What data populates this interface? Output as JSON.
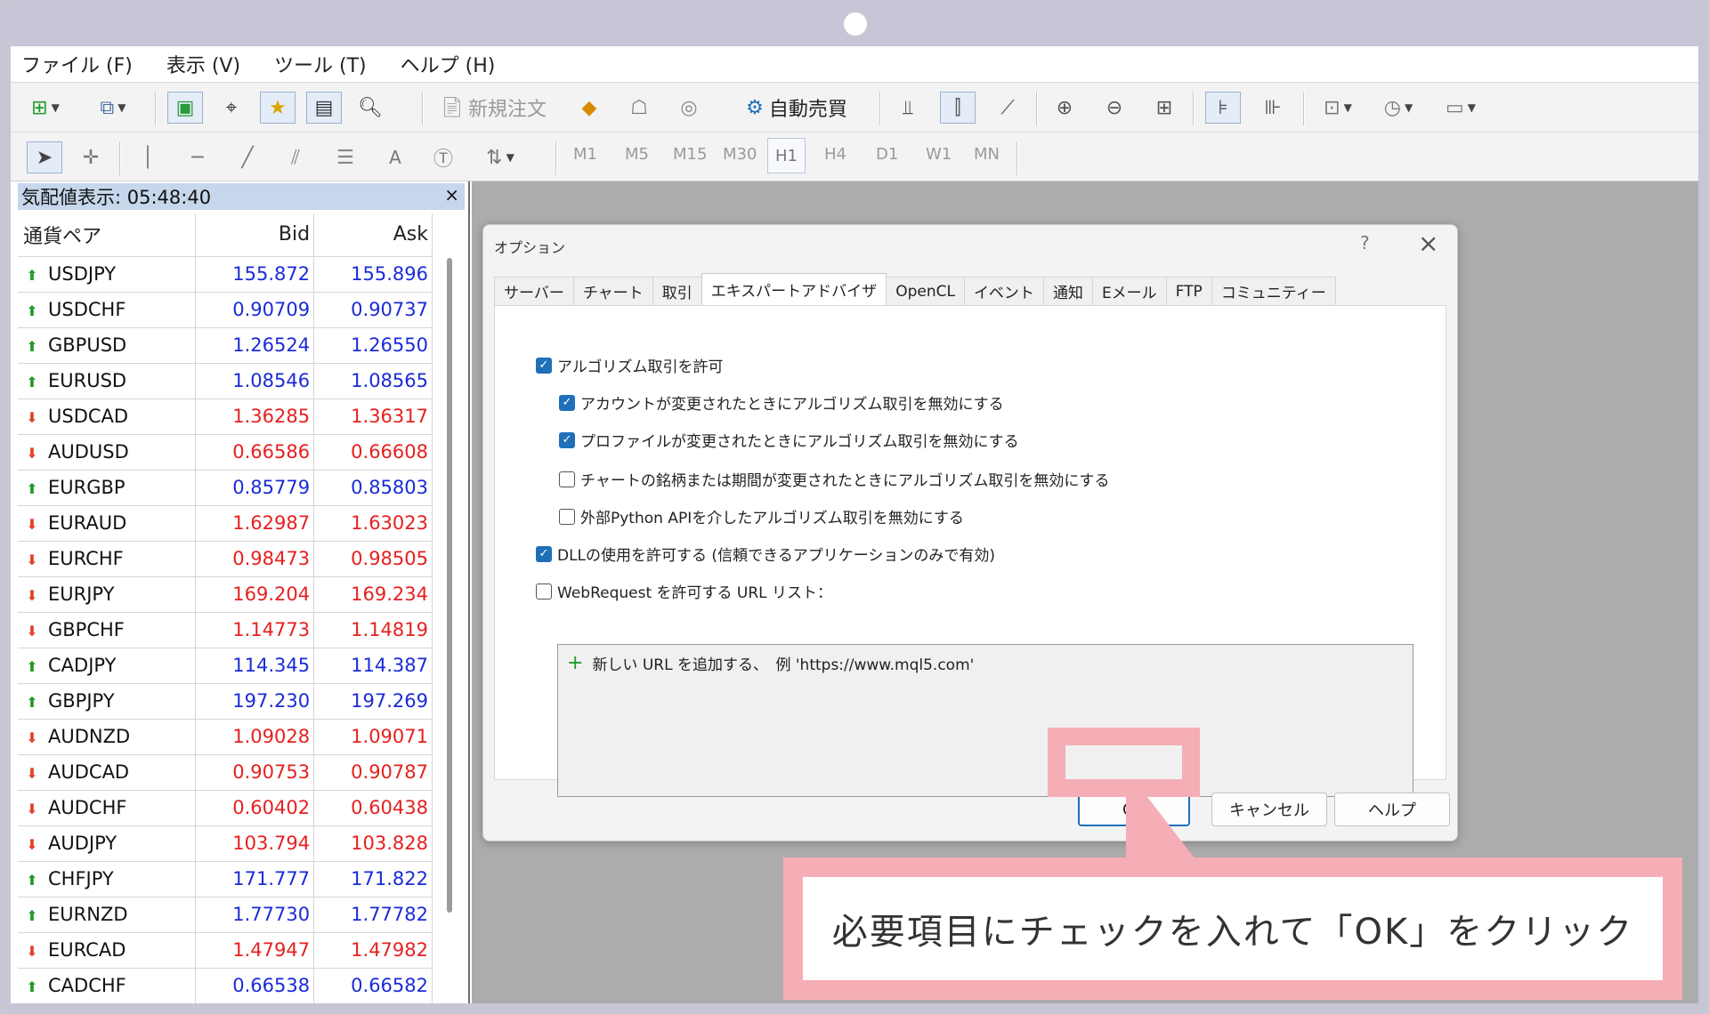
{
  "menu": [
    "ファイル (F)",
    "表示 (V)",
    "ツール (T)",
    "ヘルプ (H)"
  ],
  "toolbar": {
    "new_order": "新規注文",
    "auto_trading": "自動売買",
    "timeframes": [
      "M1",
      "M5",
      "M15",
      "M30",
      "H1",
      "H4",
      "D1",
      "W1",
      "MN"
    ],
    "active_timeframe": "H1",
    "text_tool": "A"
  },
  "market_watch": {
    "title": "気配値表示: 05:48:40",
    "close": "×",
    "columns": [
      "通貨ペア",
      "Bid",
      "Ask"
    ],
    "rows": [
      {
        "symbol": "USDJPY",
        "bid": "155.872",
        "ask": "155.896",
        "dir": "up"
      },
      {
        "symbol": "USDCHF",
        "bid": "0.90709",
        "ask": "0.90737",
        "dir": "up"
      },
      {
        "symbol": "GBPUSD",
        "bid": "1.26524",
        "ask": "1.26550",
        "dir": "up"
      },
      {
        "symbol": "EURUSD",
        "bid": "1.08546",
        "ask": "1.08565",
        "dir": "up"
      },
      {
        "symbol": "USDCAD",
        "bid": "1.36285",
        "ask": "1.36317",
        "dir": "down"
      },
      {
        "symbol": "AUDUSD",
        "bid": "0.66586",
        "ask": "0.66608",
        "dir": "down"
      },
      {
        "symbol": "EURGBP",
        "bid": "0.85779",
        "ask": "0.85803",
        "dir": "up"
      },
      {
        "symbol": "EURAUD",
        "bid": "1.62987",
        "ask": "1.63023",
        "dir": "down"
      },
      {
        "symbol": "EURCHF",
        "bid": "0.98473",
        "ask": "0.98505",
        "dir": "down"
      },
      {
        "symbol": "EURJPY",
        "bid": "169.204",
        "ask": "169.234",
        "dir": "down"
      },
      {
        "symbol": "GBPCHF",
        "bid": "1.14773",
        "ask": "1.14819",
        "dir": "down"
      },
      {
        "symbol": "CADJPY",
        "bid": "114.345",
        "ask": "114.387",
        "dir": "up"
      },
      {
        "symbol": "GBPJPY",
        "bid": "197.230",
        "ask": "197.269",
        "dir": "up"
      },
      {
        "symbol": "AUDNZD",
        "bid": "1.09028",
        "ask": "1.09071",
        "dir": "down"
      },
      {
        "symbol": "AUDCAD",
        "bid": "0.90753",
        "ask": "0.90787",
        "dir": "down"
      },
      {
        "symbol": "AUDCHF",
        "bid": "0.60402",
        "ask": "0.60438",
        "dir": "down"
      },
      {
        "symbol": "AUDJPY",
        "bid": "103.794",
        "ask": "103.828",
        "dir": "down"
      },
      {
        "symbol": "CHFJPY",
        "bid": "171.777",
        "ask": "171.822",
        "dir": "up"
      },
      {
        "symbol": "EURNZD",
        "bid": "1.77730",
        "ask": "1.77782",
        "dir": "up"
      },
      {
        "symbol": "EURCAD",
        "bid": "1.47947",
        "ask": "1.47982",
        "dir": "down"
      },
      {
        "symbol": "CADCHF",
        "bid": "0.66538",
        "ask": "0.66582",
        "dir": "up"
      }
    ]
  },
  "dialog": {
    "title": "オプション",
    "help_glyph": "?",
    "close_glyph": "×",
    "tabs": [
      "サーバー",
      "チャート",
      "取引",
      "エキスパートアドバイザ",
      "OpenCL",
      "イベント",
      "通知",
      "Eメール",
      "FTP",
      "コミュニティー"
    ],
    "active_tab": "エキスパートアドバイザ",
    "options": [
      {
        "label": "アルゴリズム取引を許可",
        "checked": true
      },
      {
        "label": "アカウントが変更されたときにアルゴリズム取引を無効にする",
        "checked": true
      },
      {
        "label": "プロファイルが変更されたときにアルゴリズム取引を無効にする",
        "checked": true
      },
      {
        "label": "チャートの銘柄または期間が変更されたときにアルゴリズム取引を無効にする",
        "checked": false
      },
      {
        "label": "外部Python APIを介したアルゴリズム取引を無効にする",
        "checked": false
      },
      {
        "label": "DLLの使用を許可する (信頼できるアプリケーションのみで有効)",
        "checked": true
      },
      {
        "label": "WebRequest を許可する URL リスト：",
        "checked": false
      }
    ],
    "url_add": "新しい URL を追加する、　例 'https://www.mql5.com'",
    "buttons": {
      "ok": "OK",
      "cancel": "キャンセル",
      "help": "ヘルプ"
    }
  },
  "callout": {
    "text": "必要項目にチェックを入れて「OK」をクリック"
  },
  "colors": {
    "up_arrow": "#1f9a2a",
    "down_arrow": "#e0402a",
    "price_up": "#1a2bd6",
    "price_down": "#e62020",
    "callout_border": "#f5aeb5",
    "checkbox_checked": "#1f6fb9",
    "market_watch_title_bg": "#c6d7ec"
  }
}
